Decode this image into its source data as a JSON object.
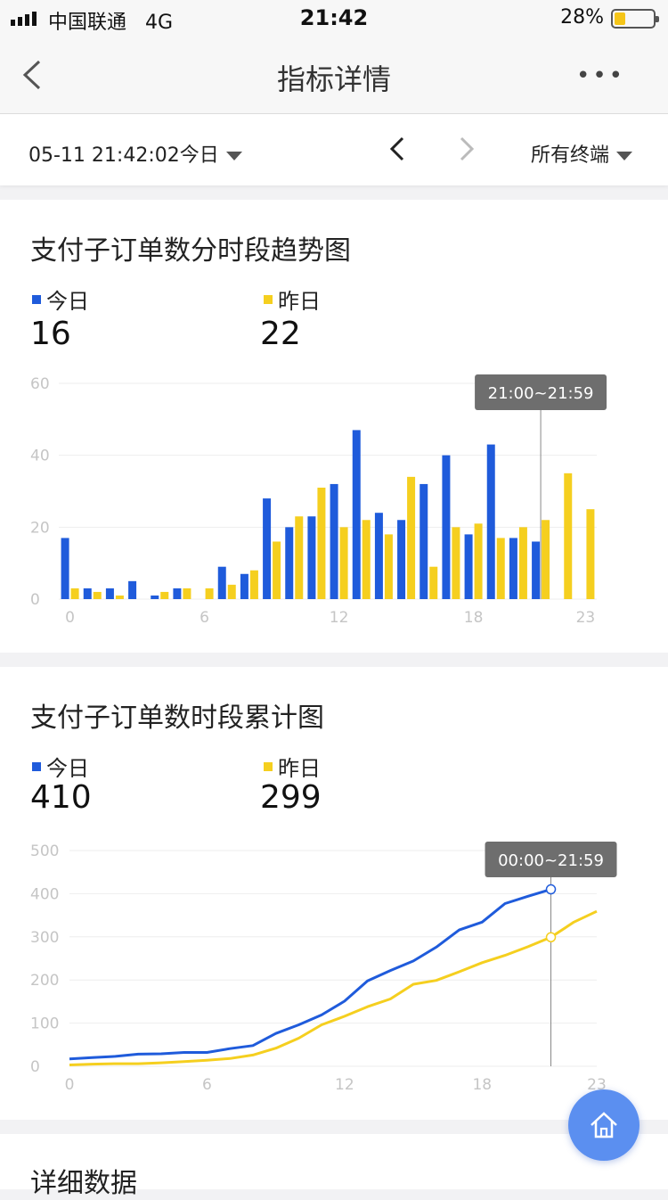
{
  "status_bar": {
    "carrier": "中国联通",
    "network": "4G",
    "time": "21:42",
    "battery_percent": "28%",
    "battery_level": 0.28
  },
  "nav": {
    "title": "指标详情",
    "back_icon": "chevron-left-icon",
    "more_icon": "more-dots-icon",
    "more_label": "•••"
  },
  "filter": {
    "date_label": "05-11 21:42:02今日",
    "terminal_label": "所有终端"
  },
  "colors": {
    "today": "#1f5bdb",
    "yesterday": "#f5cf1f",
    "grid": "#eeeeee",
    "tick": "#c5c5c5",
    "tooltip_bg": "#6e6e6e",
    "fab": "#5b8ff0"
  },
  "card_hourly": {
    "title": "支付子订单数分时段趋势图",
    "today_label": "今日",
    "today_value": "16",
    "yesterday_label": "昨日",
    "yesterday_value": "22"
  },
  "card_cumulative": {
    "title": "支付子订单数时段累计图",
    "today_label": "今日",
    "today_value": "410",
    "yesterday_label": "昨日",
    "yesterday_value": "299"
  },
  "card_detail": {
    "title": "详细数据"
  },
  "chart_data": [
    {
      "type": "bar",
      "categories": [
        0,
        1,
        2,
        3,
        4,
        5,
        6,
        7,
        8,
        9,
        10,
        11,
        12,
        13,
        14,
        15,
        16,
        17,
        18,
        19,
        20,
        21,
        22,
        23
      ],
      "x_tick_labels": [
        "0",
        "6",
        "12",
        "18",
        "23"
      ],
      "x_tick_positions": [
        0,
        6,
        12,
        18,
        23
      ],
      "y_tick_labels": [
        "0",
        "20",
        "40",
        "60"
      ],
      "ylim": [
        0,
        60
      ],
      "series": [
        {
          "name": "今日",
          "color": "#1f5bdb",
          "values": [
            17,
            3,
            3,
            5,
            1,
            3,
            0,
            9,
            7,
            28,
            20,
            23,
            32,
            47,
            24,
            22,
            32,
            40,
            18,
            43,
            17,
            16,
            null,
            null
          ]
        },
        {
          "name": "昨日",
          "color": "#f5cf1f",
          "values": [
            3,
            2,
            1,
            0,
            2,
            3,
            3,
            4,
            8,
            16,
            23,
            31,
            20,
            22,
            18,
            34,
            9,
            20,
            21,
            17,
            20,
            22,
            35,
            25
          ]
        }
      ],
      "tooltip": {
        "label": "21:00~21:59",
        "x": 21
      },
      "grid": true
    },
    {
      "type": "line",
      "x": [
        0,
        1,
        2,
        3,
        4,
        5,
        6,
        7,
        8,
        9,
        10,
        11,
        12,
        13,
        14,
        15,
        16,
        17,
        18,
        19,
        20,
        21,
        22,
        23
      ],
      "x_tick_labels": [
        "0",
        "6",
        "12",
        "18",
        "23"
      ],
      "x_tick_positions": [
        0,
        6,
        12,
        18,
        23
      ],
      "y_tick_labels": [
        "0",
        "100",
        "200",
        "300",
        "400",
        "500"
      ],
      "ylim": [
        0,
        500
      ],
      "series": [
        {
          "name": "今日",
          "color": "#1f5bdb",
          "values": [
            17,
            20,
            23,
            28,
            29,
            32,
            32,
            41,
            48,
            76,
            96,
            119,
            151,
            198,
            222,
            244,
            276,
            316,
            334,
            377,
            394,
            410,
            null,
            null
          ]
        },
        {
          "name": "昨日",
          "color": "#f5cf1f",
          "values": [
            3,
            5,
            6,
            6,
            8,
            11,
            14,
            18,
            26,
            42,
            65,
            96,
            116,
            138,
            156,
            190,
            199,
            219,
            240,
            257,
            277,
            299,
            334,
            359
          ]
        }
      ],
      "tooltip": {
        "label": "00:00~21:59",
        "x": 21
      },
      "grid": true
    }
  ]
}
